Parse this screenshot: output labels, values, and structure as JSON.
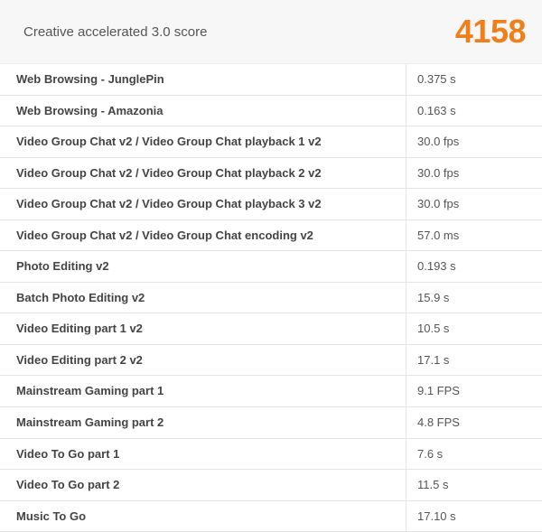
{
  "header": {
    "title": "Creative accelerated 3.0 score",
    "score": "4158"
  },
  "rows": [
    {
      "label": "Web Browsing - JunglePin",
      "value": "0.375 s"
    },
    {
      "label": "Web Browsing - Amazonia",
      "value": "0.163 s"
    },
    {
      "label": "Video Group Chat v2 / Video Group Chat playback 1 v2",
      "value": "30.0 fps"
    },
    {
      "label": "Video Group Chat v2 / Video Group Chat playback 2 v2",
      "value": "30.0 fps"
    },
    {
      "label": "Video Group Chat v2 / Video Group Chat playback 3 v2",
      "value": "30.0 fps"
    },
    {
      "label": "Video Group Chat v2 / Video Group Chat encoding v2",
      "value": "57.0 ms"
    },
    {
      "label": "Photo Editing v2",
      "value": "0.193 s"
    },
    {
      "label": "Batch Photo Editing v2",
      "value": "15.9 s"
    },
    {
      "label": "Video Editing part 1 v2",
      "value": "10.5 s"
    },
    {
      "label": "Video Editing part 2 v2",
      "value": "17.1 s"
    },
    {
      "label": "Mainstream Gaming part 1",
      "value": "9.1 FPS"
    },
    {
      "label": "Mainstream Gaming part 2",
      "value": "4.8 FPS"
    },
    {
      "label": "Video To Go part 1",
      "value": "7.6 s"
    },
    {
      "label": "Video To Go part 2",
      "value": "11.5 s"
    },
    {
      "label": "Music To Go",
      "value": "17.10 s"
    }
  ]
}
